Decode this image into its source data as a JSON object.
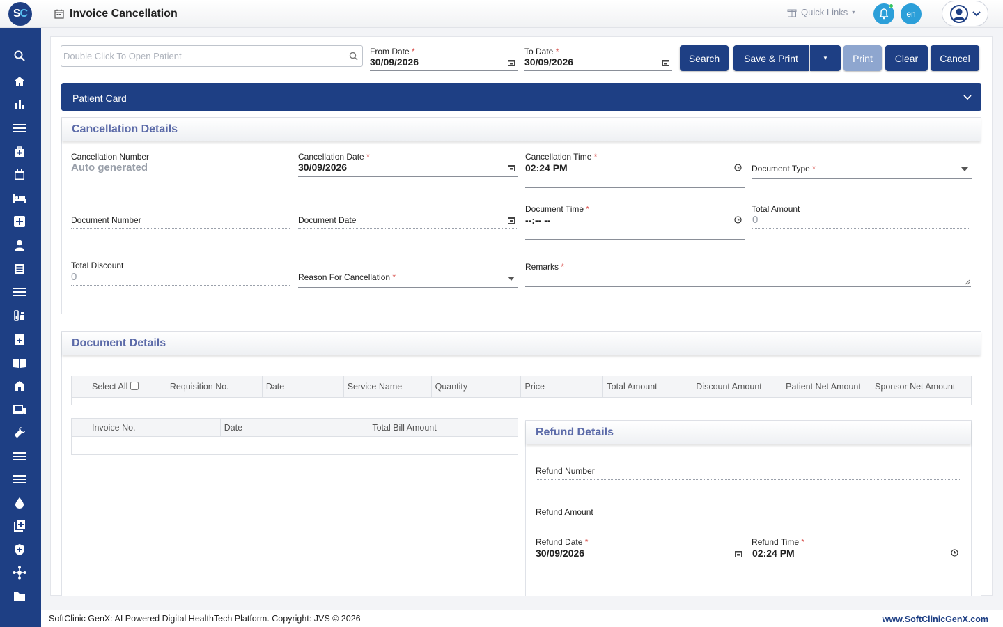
{
  "header": {
    "logo_s": "S",
    "logo_c": "C",
    "page_title": "Invoice Cancellation",
    "quick_links": "Quick Links",
    "lang": "en"
  },
  "sidebar": {
    "icons": [
      "search-icon",
      "home-icon",
      "bar-chart-icon",
      "menu-icon",
      "medical-bag-icon",
      "calendar-icon",
      "bed-icon",
      "hospital-plus-icon",
      "user-icon",
      "receipt-icon",
      "menu-icon",
      "lab-icon",
      "pharmacy-icon",
      "book-icon",
      "building-icon",
      "devices-icon",
      "wrench-icon",
      "menu-icon",
      "menu-icon",
      "blood-drop-icon",
      "add-box-icon",
      "shield-icon",
      "network-icon",
      "folder-icon"
    ]
  },
  "toolbar": {
    "patient_placeholder": "Double Click To Open Patient",
    "from_date_label": "From Date",
    "from_date_value": "30/09/2026",
    "to_date_label": "To Date",
    "to_date_value": "30/09/2026",
    "search_label": "Search",
    "save_print_label": "Save & Print",
    "print_label": "Print",
    "clear_label": "Clear",
    "cancel_label": "Cancel"
  },
  "patient_card": {
    "title": "Patient Card"
  },
  "cancellation": {
    "title": "Cancellation Details",
    "cancellation_number_label": "Cancellation Number",
    "cancellation_number_value": "Auto generated",
    "cancellation_date_label": "Cancellation Date",
    "cancellation_date_value": "30/09/2026",
    "cancellation_time_label": "Cancellation Time",
    "cancellation_time_value": "02:24  PM",
    "document_type_label": "Document Type",
    "document_number_label": "Document Number",
    "document_date_label": "Document Date",
    "document_time_label": "Document Time",
    "document_time_value": "--:-- --",
    "total_amount_label": "Total Amount",
    "total_amount_value": "0",
    "total_discount_label": "Total Discount",
    "total_discount_value": "0",
    "reason_label": "Reason For Cancellation",
    "remarks_label": "Remarks"
  },
  "document_details": {
    "title": "Document Details",
    "select_all_label": "Select All",
    "columns": [
      "Requisition No.",
      "Date",
      "Service Name",
      "Quantity",
      "Price",
      "Total Amount",
      "Discount Amount",
      "Patient Net Amount",
      "Sponsor Net Amount"
    ]
  },
  "invoice_table": {
    "columns": [
      "Invoice No.",
      "Date",
      "Total Bill Amount"
    ]
  },
  "refund": {
    "title": "Refund Details",
    "refund_number_label": "Refund Number",
    "refund_amount_label": "Refund Amount",
    "refund_date_label": "Refund Date",
    "refund_date_value": "30/09/2026",
    "refund_time_label": "Refund Time",
    "refund_time_value": "02:24  PM"
  },
  "footer": {
    "copyright": "SoftClinic GenX: AI Powered Digital HealthTech Platform. Copyright: JVS © 2026",
    "website": "www.SoftClinicGenX.com"
  },
  "colors": {
    "primary": "#1e3f84",
    "accent": "#2c9fd9",
    "section_title": "#5b6aa8",
    "required": "#d9534f"
  }
}
